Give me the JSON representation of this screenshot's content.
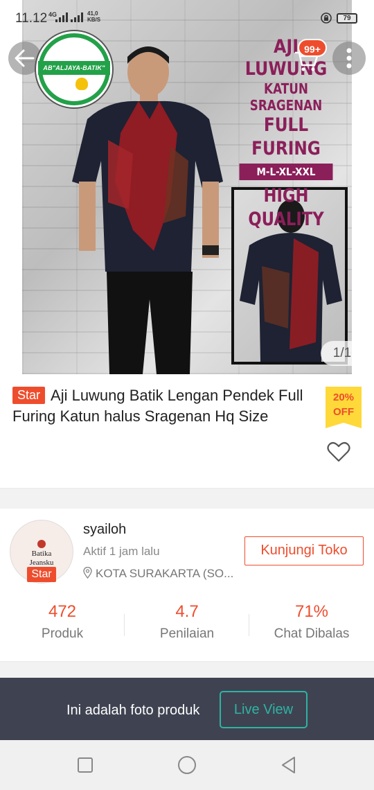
{
  "status_bar": {
    "time": "11.12",
    "network": "4G",
    "speed_value": "41,0",
    "speed_unit": "KB/S",
    "battery": "79"
  },
  "cart": {
    "badge": "99+"
  },
  "hero": {
    "logo_text": "AB\"ALJAYA-BATIK\"",
    "promo_line1": "AJI LUWUNG",
    "promo_line2": "KATUN SRAGENAN",
    "promo_line3": "FULL FURING",
    "promo_sizes": "M-L-XL-XXL",
    "promo_line4": "HIGH QUALITY",
    "page_indicator": "1/1"
  },
  "product": {
    "tag": "Star",
    "title": "Aji Luwung Batik Lengan Pendek Full Furing Katun halus Sragenan Hq Size",
    "discount_pct": "20%",
    "discount_label": "OFF"
  },
  "shop": {
    "avatar_line1": "Batika",
    "avatar_line2": "Jeansku",
    "avatar_tag": "Star",
    "name": "syailoh",
    "active": "Aktif 1 jam lalu",
    "location": "KOTA SURAKARTA (SO...",
    "visit_label": "Kunjungi Toko",
    "stats": [
      {
        "value": "472",
        "label": "Produk"
      },
      {
        "value": "4.7",
        "label": "Penilaian"
      },
      {
        "value": "71%",
        "label": "Chat Dibalas"
      }
    ]
  },
  "live_bar": {
    "text": "Ini adalah foto produk",
    "button": "Live View"
  },
  "colors": {
    "accent": "#ee4d2d",
    "discount_bg": "#ffd839",
    "live_bar_bg": "#3f4351",
    "live_button": "#2fb3a3"
  },
  "icons": [
    "back-arrow-icon",
    "cart-icon",
    "more-vertical-icon",
    "heart-icon",
    "location-pin-icon",
    "square-nav-icon",
    "home-circle-nav-icon",
    "back-triangle-nav-icon"
  ]
}
